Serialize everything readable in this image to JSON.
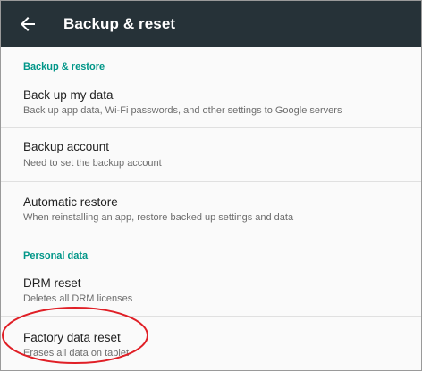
{
  "appbar": {
    "title": "Backup & reset",
    "back_icon": "arrow-back-icon"
  },
  "sections": {
    "backup_restore": {
      "header": "Backup & restore",
      "items": [
        {
          "title": "Back up my data",
          "summary": "Back up app data, Wi-Fi passwords, and other settings to Google servers"
        },
        {
          "title": "Backup account",
          "summary": "Need to set the backup account"
        },
        {
          "title": "Automatic restore",
          "summary": "When reinstalling an app, restore backed up settings and data"
        }
      ]
    },
    "personal_data": {
      "header": "Personal data",
      "items": [
        {
          "title": "DRM reset",
          "summary": "Deletes all DRM licenses"
        },
        {
          "title": "Factory data reset",
          "summary": "Erases all data on tablet"
        }
      ]
    }
  },
  "colors": {
    "appbar": "#263238",
    "accent": "#009688",
    "highlight": "#e01f26"
  }
}
